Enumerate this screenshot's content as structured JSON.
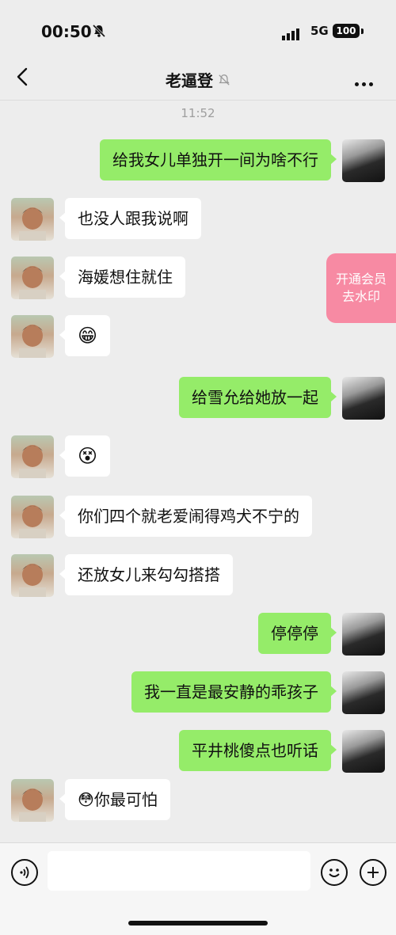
{
  "status_bar": {
    "time": "00:50",
    "network": "5G",
    "battery": "100"
  },
  "header": {
    "title": "老逼登"
  },
  "chat": {
    "timestamp": "11:52",
    "messages": [
      {
        "side": "me",
        "text": "给我女儿单独开一间为啥不行"
      },
      {
        "side": "them",
        "text": "也没人跟我说啊"
      },
      {
        "side": "them",
        "text": "海媛想住就住"
      },
      {
        "side": "them",
        "text": "😁"
      },
      {
        "side": "me",
        "text": "给雪允给她放一起"
      },
      {
        "side": "them",
        "text": "😵"
      },
      {
        "side": "them",
        "text": "你们四个就老爱闹得鸡犬不宁的"
      },
      {
        "side": "them",
        "text": "还放女儿来勾勾搭搭"
      },
      {
        "side": "me",
        "text": "停停停"
      },
      {
        "side": "me",
        "text": "我一直是最安静的乖孩子"
      },
      {
        "side": "me",
        "text": "平井桃傻点也听话"
      },
      {
        "side": "them",
        "text": "😳你最可怕"
      }
    ]
  },
  "promo": {
    "line1": "开通会员",
    "line2": "去水印"
  },
  "icons": {
    "back": "chevron-left-icon",
    "mute": "bell-off-icon",
    "more": "more-dots-icon",
    "voice": "voice-icon",
    "emoji": "smile-icon",
    "add": "plus-icon"
  },
  "colors": {
    "my_bubble": "#95ec69",
    "their_bubble": "#ffffff",
    "background": "#ededed",
    "promo": "#f78aa3"
  }
}
